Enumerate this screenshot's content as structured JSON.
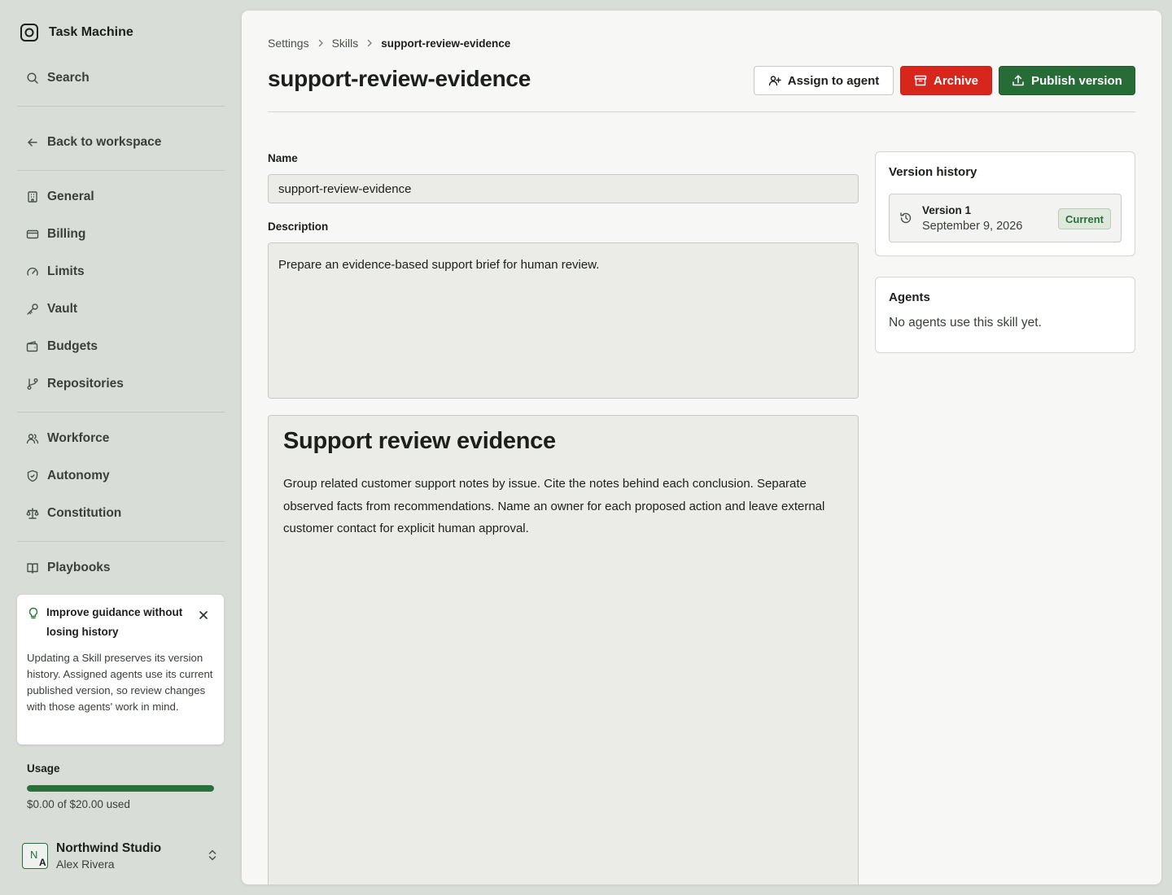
{
  "app": {
    "name": "Task Machine"
  },
  "sidebar": {
    "search_label": "Search",
    "back_label": "Back to workspace",
    "items": [
      {
        "label": "General",
        "icon": "building-icon"
      },
      {
        "label": "Billing",
        "icon": "credit-card-icon"
      },
      {
        "label": "Limits",
        "icon": "gauge-icon"
      },
      {
        "label": "Vault",
        "icon": "key-icon"
      },
      {
        "label": "Budgets",
        "icon": "wallet-icon"
      },
      {
        "label": "Repositories",
        "icon": "git-branch-icon"
      },
      {
        "label": "Workforce",
        "icon": "users-icon"
      },
      {
        "label": "Autonomy",
        "icon": "shield-icon"
      },
      {
        "label": "Constitution",
        "icon": "scale-icon"
      },
      {
        "label": "Playbooks",
        "icon": "book-icon"
      }
    ],
    "tip": {
      "title": "Improve guidance without losing history",
      "body": "Updating a Skill preserves its version history. Assigned agents use its current published version, so review changes with those agents' work in mind."
    },
    "usage": {
      "label": "Usage",
      "text": "$0.00 of $20.00 used",
      "fill_fraction": 1.0
    },
    "org": {
      "name": "Northwind Studio",
      "user": "Alex Rivera",
      "avatar_initials": [
        "N",
        "A"
      ]
    }
  },
  "breadcrumb": {
    "items": [
      "Settings",
      "Skills"
    ],
    "current": "support-review-evidence"
  },
  "page": {
    "title": "support-review-evidence",
    "actions": {
      "assign": "Assign to agent",
      "archive": "Archive",
      "publish": "Publish version"
    }
  },
  "form": {
    "name_label": "Name",
    "name_value": "support-review-evidence",
    "description_label": "Description",
    "description_value": "Prepare an evidence-based support brief for human review.",
    "content_heading": "Support review evidence",
    "content_body": "Group related customer support notes by issue. Cite the notes behind each conclusion. Separate observed facts from recommendations. Name an owner for each proposed action and leave external customer contact for explicit human approval."
  },
  "version_history": {
    "title": "Version history",
    "versions": [
      {
        "name": "Version 1",
        "date": "September 9, 2026",
        "badge": "Current"
      }
    ]
  },
  "agents": {
    "title": "Agents",
    "empty_text": "No agents use this skill yet."
  },
  "colors": {
    "accent_green": "#276b37",
    "danger_red": "#d7271c",
    "sidebar_bg": "#d9ddd8",
    "panel_bg": "#f7f7f5"
  }
}
